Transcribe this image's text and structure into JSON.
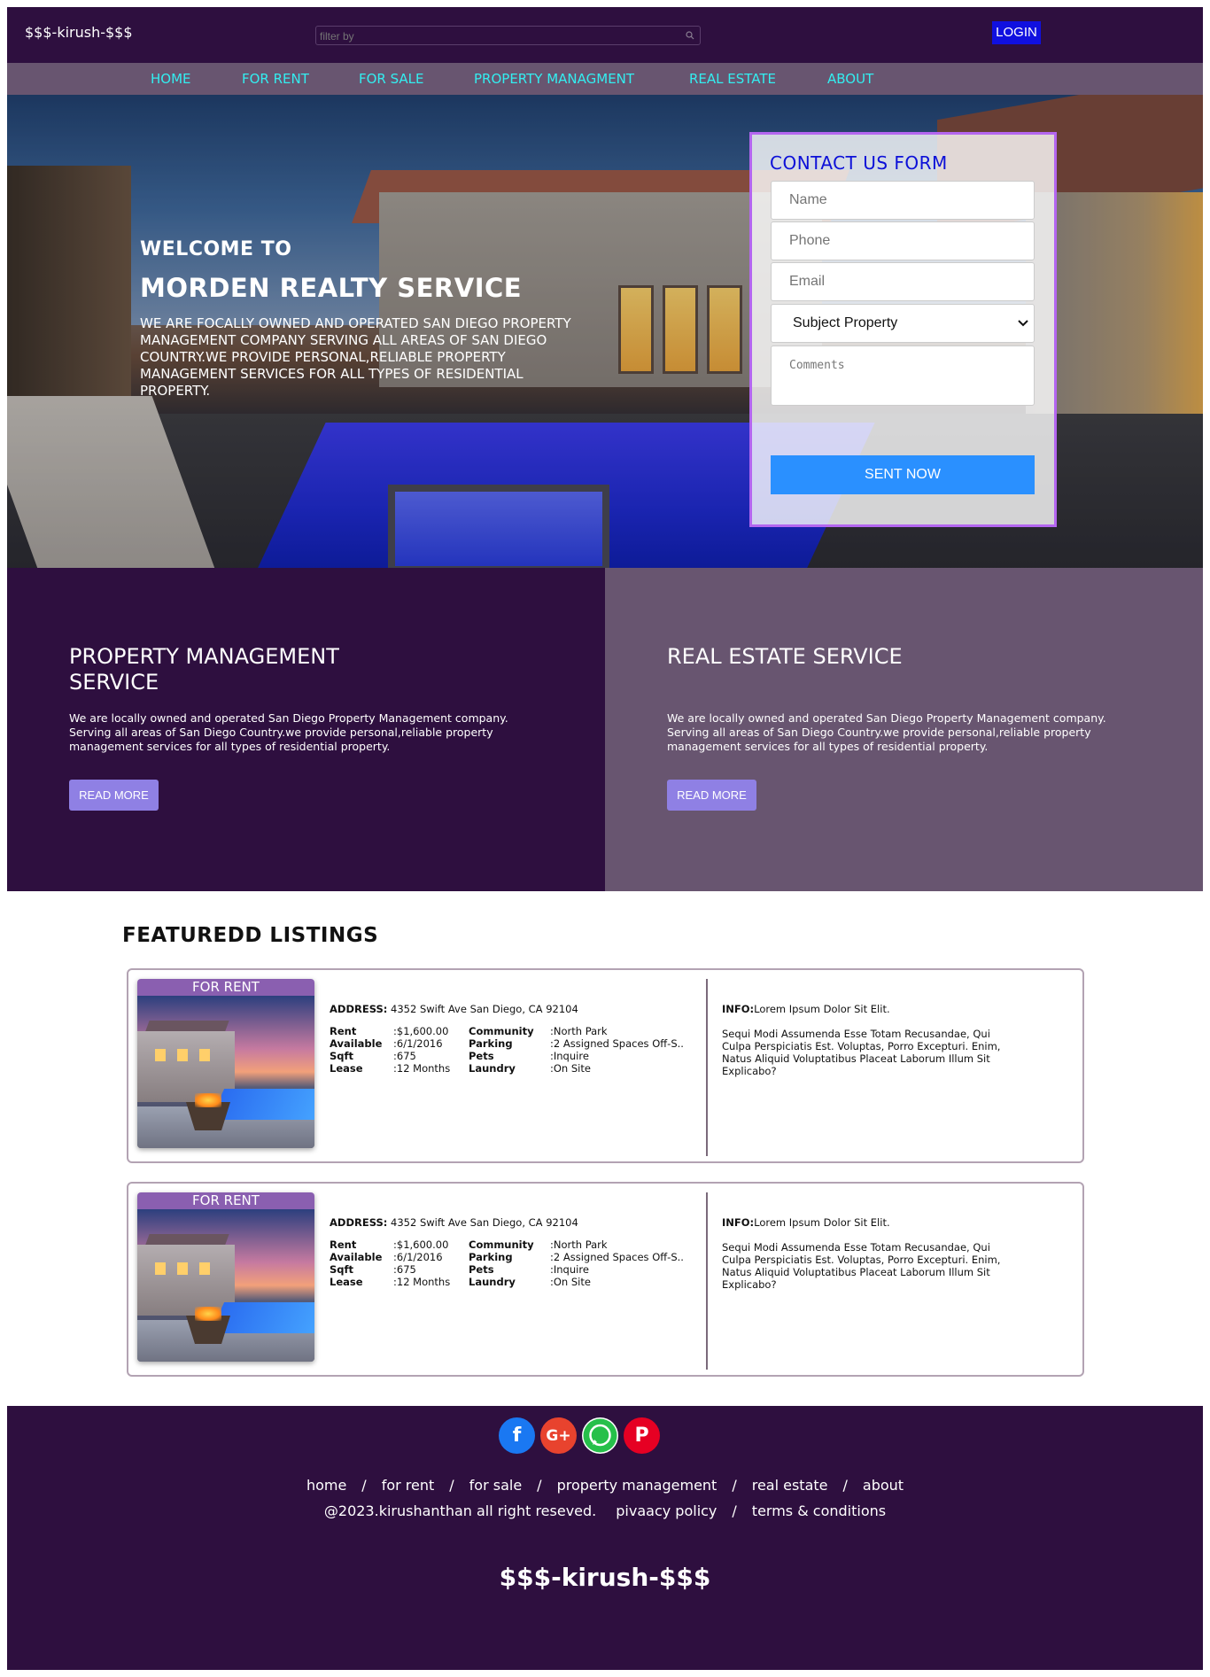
{
  "header": {
    "brand": "$$$-kirush-$$$",
    "filter_placeholder": "filter by",
    "login_label": "LOGIN"
  },
  "nav": {
    "items": [
      "HOME",
      "FOR RENT",
      "FOR SALE",
      "PROPERTY MANAGMENT",
      "REAL ESTATE",
      "ABOUT"
    ]
  },
  "hero": {
    "welcome": "WELCOME TO",
    "title": "MORDEN REALTY SERVICE",
    "description": "WE ARE FOCALLY OWNED AND OPERATED SAN DIEGO PROPERTY MANAGEMENT COMPANY SERVING ALL AREAS OF SAN DIEGO COUNTRY.WE PROVIDE PERSONAL,RELIABLE PROPERTY MANAGEMENT SERVICES FOR ALL TYPES OF RESIDENTIAL PROPERTY."
  },
  "contact": {
    "title": "CONTACT US FORM",
    "name_placeholder": "Name",
    "phone_placeholder": "Phone",
    "email_placeholder": "Email",
    "subject_selected": "Subject Property",
    "comments_placeholder": "Comments",
    "submit_label": "SENT NOW"
  },
  "services": [
    {
      "title": "PROPERTY MANAGEMENT SERVICE",
      "text": "We are locally owned and operated San Diego Property Management company. Serving all areas of San Diego Country.we provide personal,reliable property management services for all types of residential property.",
      "button": "READ MORE"
    },
    {
      "title": "REAL ESTATE SERVICE",
      "text": "We are locally owned and operated San Diego Property Management company. Serving all areas of San Diego Country.we provide personal,reliable property management services for all types of residential property.",
      "button": "READ MORE"
    }
  ],
  "listings": {
    "title": "FEATUREDD LISTINGS",
    "items": [
      {
        "badge": "FOR RENT",
        "address_label": "ADDRESS:",
        "address": "4352 Swift Ave San Diego, CA 92104",
        "rent_label": "Rent",
        "rent": ":$1,600.00",
        "available_label": "Available",
        "available": ":6/1/2016",
        "sqft_label": "Sqft",
        "sqft": ":675",
        "lease_label": "Lease",
        "lease": ":12 Months",
        "community_label": "Community",
        "community": ":North Park",
        "parking_label": "Parking",
        "parking": ":2 Assigned Spaces Off-S..",
        "pets_label": "Pets",
        "pets": ":Inquire",
        "laundry_label": "Laundry",
        "laundry": ":On Site",
        "info_label": "INFO:",
        "info": "Lorem Ipsum Dolor Sit Elit.",
        "info_body": "Sequi Modi Assumenda Esse Totam Recusandae, Qui Culpa Perspiciatis Est. Voluptas, Porro Excepturi. Enim, Natus Aliquid Voluptatibus Placeat Laborum Illum Sit Explicabo?"
      },
      {
        "badge": "FOR RENT",
        "address_label": "ADDRESS:",
        "address": "4352 Swift Ave San Diego, CA 92104",
        "rent_label": "Rent",
        "rent": ":$1,600.00",
        "available_label": "Available",
        "available": ":6/1/2016",
        "sqft_label": "Sqft",
        "sqft": ":675",
        "lease_label": "Lease",
        "lease": ":12 Months",
        "community_label": "Community",
        "community": ":North Park",
        "parking_label": "Parking",
        "parking": ":2 Assigned Spaces Off-S..",
        "pets_label": "Pets",
        "pets": ":Inquire",
        "laundry_label": "Laundry",
        "laundry": ":On Site",
        "info_label": "INFO:",
        "info": "Lorem Ipsum Dolor Sit Elit.",
        "info_body": "Sequi Modi Assumenda Esse Totam Recusandae, Qui Culpa Perspiciatis Est. Voluptas, Porro Excepturi. Enim, Natus Aliquid Voluptatibus Placeat Laborum Illum Sit Explicabo?"
      }
    ]
  },
  "footer": {
    "social_icons": [
      "facebook-icon",
      "google-plus-icon",
      "whatsapp-icon",
      "pinterest-icon"
    ],
    "links": [
      "home",
      "for rent",
      "for sale",
      "property management",
      "real estate",
      "about"
    ],
    "separator": "/",
    "copyright": "@2023.kirushanthan all right reseved.",
    "privacy": "pivaacy policy",
    "terms": "terms & conditions",
    "brand": "$$$-kirush-$$$"
  },
  "colors": {
    "dark_purple": "#2e0f3f",
    "mid_purple": "#685570",
    "nav_text": "#33eef0",
    "login_blue": "#1010e0",
    "form_border": "#b466f0",
    "send_blue": "#2a90ff",
    "read_more": "#8f80e4"
  }
}
